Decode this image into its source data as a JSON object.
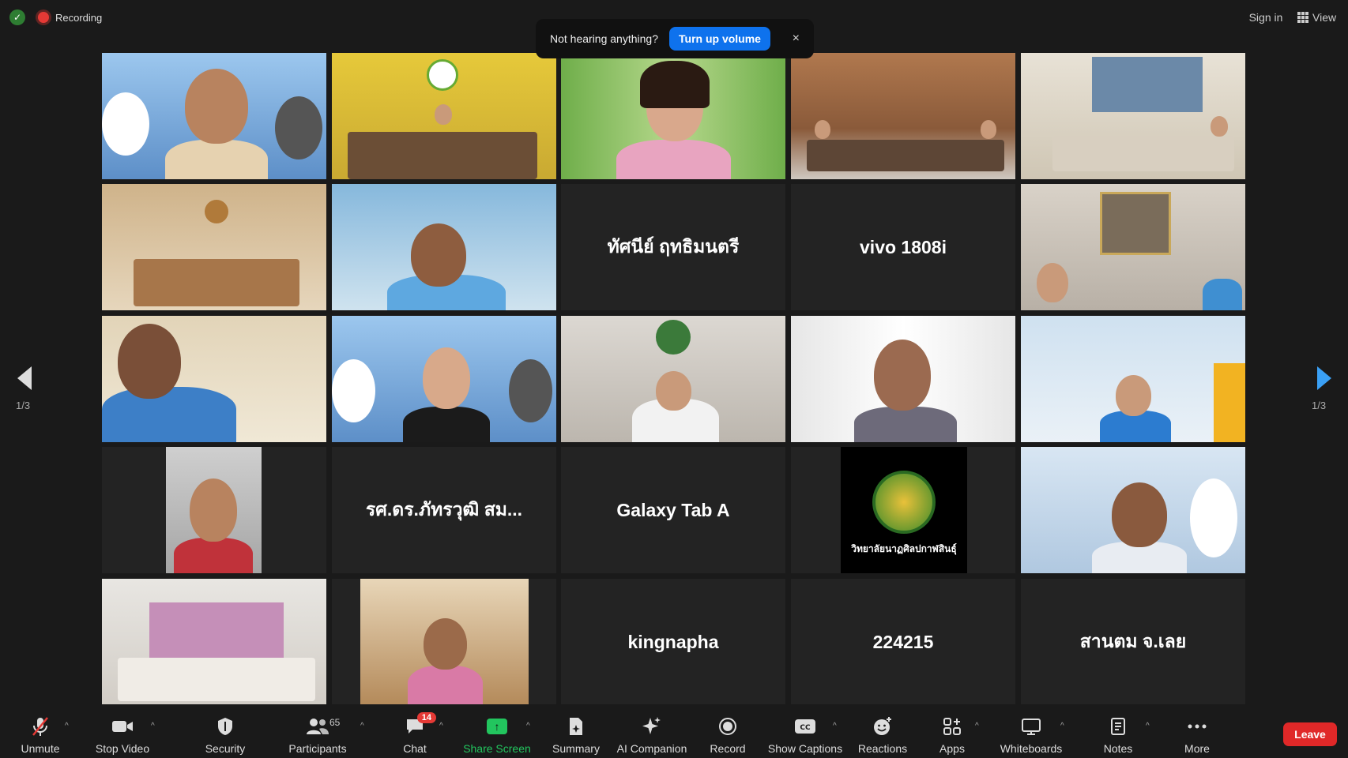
{
  "topbar": {
    "recording_label": "Recording",
    "sign_in_label": "Sign in",
    "view_label": "View"
  },
  "toast": {
    "message": "Not hearing anything?",
    "action_label": "Turn up volume",
    "close_glyph": "×"
  },
  "pagination": {
    "left_label": "1/3",
    "right_label": "1/3"
  },
  "tiles": [
    {
      "type": "video"
    },
    {
      "type": "video"
    },
    {
      "type": "video",
      "active": true
    },
    {
      "type": "video"
    },
    {
      "type": "video"
    },
    {
      "type": "video"
    },
    {
      "type": "video"
    },
    {
      "type": "name",
      "name": "ทัศนีย์ ฤทธิมนตรี"
    },
    {
      "type": "name",
      "name": "vivo 1808i"
    },
    {
      "type": "video"
    },
    {
      "type": "video"
    },
    {
      "type": "video"
    },
    {
      "type": "video"
    },
    {
      "type": "video"
    },
    {
      "type": "video"
    },
    {
      "type": "video"
    },
    {
      "type": "name",
      "name": "รศ.ดร.ภัทรวุฒิ สม..."
    },
    {
      "type": "name",
      "name": "Galaxy Tab A"
    },
    {
      "type": "logo",
      "logo_text": "วิทยาลัยนาฏศิลปกาฬสินธุ์"
    },
    {
      "type": "video"
    },
    {
      "type": "video"
    },
    {
      "type": "video"
    },
    {
      "type": "name",
      "name": "kingnapha"
    },
    {
      "type": "name",
      "name": "224215"
    },
    {
      "type": "name",
      "name": "สานตม จ.เลย"
    }
  ],
  "toolbar": {
    "unmute": "Unmute",
    "stop_video": "Stop Video",
    "security": "Security",
    "participants": "Participants",
    "participants_count": "65",
    "chat": "Chat",
    "chat_badge": "14",
    "share_screen": "Share Screen",
    "summary": "Summary",
    "ai_companion": "AI Companion",
    "record": "Record",
    "show_captions": "Show Captions",
    "reactions": "Reactions",
    "apps": "Apps",
    "whiteboards": "Whiteboards",
    "notes": "Notes",
    "more": "More",
    "leave": "Leave"
  },
  "colors": {
    "background": "#1a1a1a",
    "tile": "#232323",
    "active_speaker": "#f5e04a",
    "primary_blue": "#0e72ed",
    "share_green": "#22c55e",
    "leave_red": "#e02828"
  }
}
